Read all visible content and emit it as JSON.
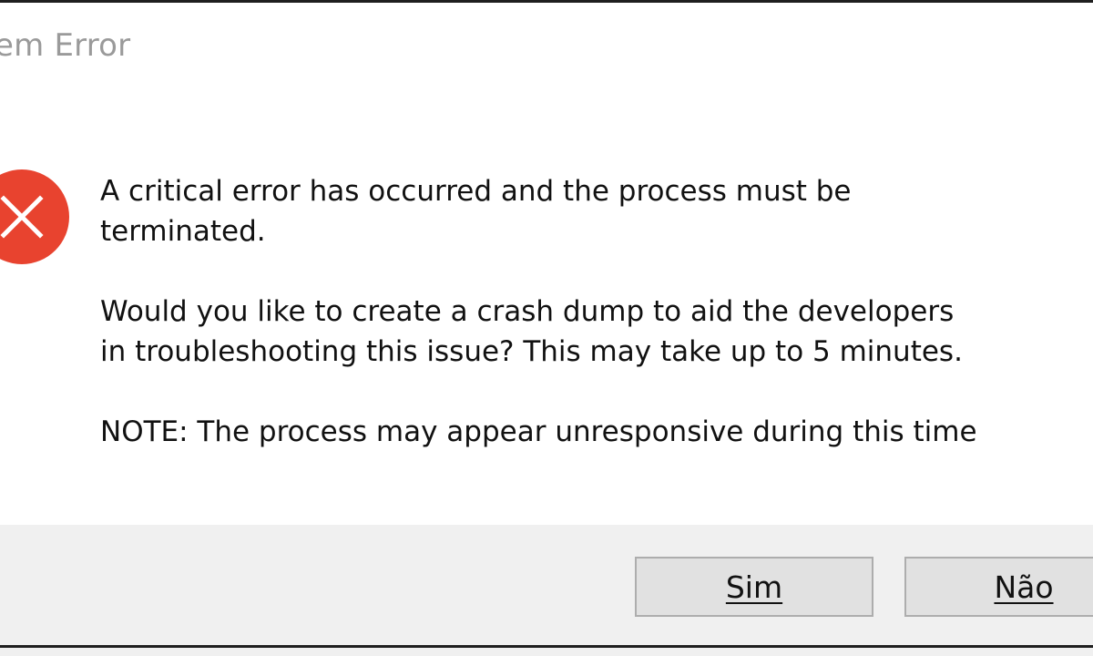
{
  "window": {
    "title": "em Error"
  },
  "icon": {
    "name": "error-icon",
    "color": "#e8432f"
  },
  "message": {
    "line1": "A critical error has occurred and the process must be",
    "line2": "terminated.",
    "line3": "Would you like to create a crash dump to aid the developers",
    "line4": "in troubleshooting this issue? This may take up to 5 minutes.",
    "line5": "NOTE: The process may appear unresponsive during this time"
  },
  "buttons": {
    "yes_label": "Sim",
    "no_label": "Não"
  }
}
